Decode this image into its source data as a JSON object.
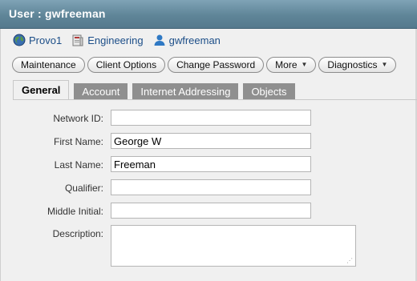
{
  "window": {
    "title": "User : gwfreeman"
  },
  "breadcrumb": [
    {
      "label": "Provo1",
      "icon": "globe-icon"
    },
    {
      "label": "Engineering",
      "icon": "folder-icon"
    },
    {
      "label": "gwfreeman",
      "icon": "user-icon"
    }
  ],
  "toolbar": {
    "maintenance": "Maintenance",
    "client_options": "Client Options",
    "change_password": "Change Password",
    "more": "More",
    "diagnostics": "Diagnostics"
  },
  "tabs": {
    "general": "General",
    "account": "Account",
    "internet_addressing": "Internet Addressing",
    "objects": "Objects"
  },
  "form": {
    "network_id": {
      "label": "Network ID:",
      "value": ""
    },
    "first_name": {
      "label": "First Name:",
      "value": "George W"
    },
    "last_name": {
      "label": "Last Name:",
      "value": "Freeman"
    },
    "qualifier": {
      "label": "Qualifier:",
      "value": ""
    },
    "middle_initial": {
      "label": "Middle Initial:",
      "value": ""
    },
    "description": {
      "label": "Description:",
      "value": ""
    }
  },
  "colors": {
    "titlebar": "#5f8598",
    "link": "#1c4e88",
    "tab_inactive": "#8f8f8f",
    "background": "#f0f0f0"
  }
}
